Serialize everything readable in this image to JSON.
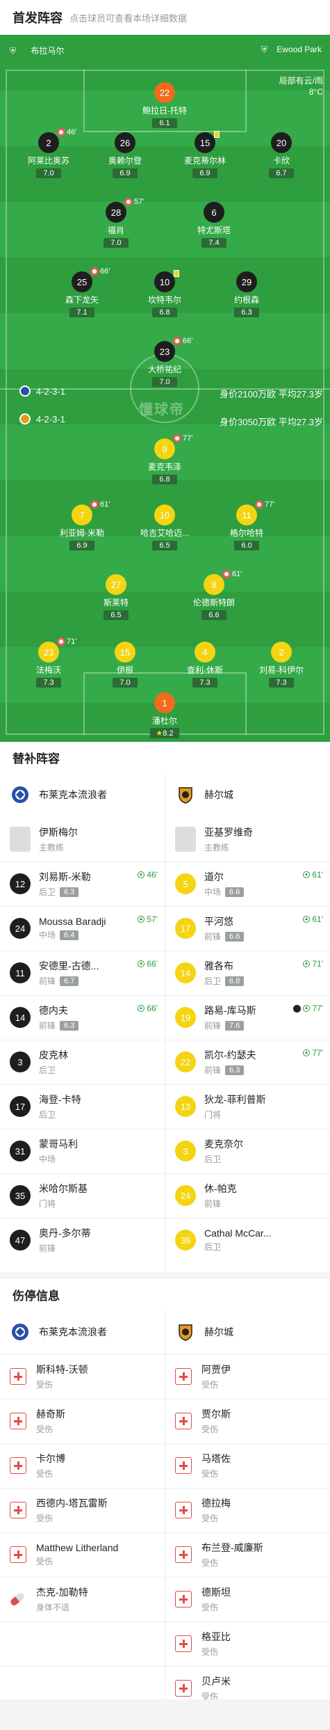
{
  "header": {
    "title": "首发阵容",
    "subtitle": "点击球员可查看本场详细数据"
  },
  "pitch": {
    "home_team": "布拉马尔",
    "away_team": "Ewood Park",
    "weather": [
      "局部有云/雨",
      "8°C"
    ],
    "watermark": "懂球帝",
    "home_formation": "4-2-3-1",
    "home_value": "身价2100万欧 平均27.3岁",
    "away_formation": "4-2-3-1",
    "away_value": "身价3050万欧 平均27.3岁"
  },
  "home_players": [
    {
      "num": "22",
      "name": "鲍拉日-托特",
      "rating": "6.1",
      "type": "gk"
    },
    {
      "num": "2",
      "name": "阿莱比奥苏",
      "rating": "7.0",
      "sub": "46'"
    },
    {
      "num": "26",
      "name": "奥赖尔登",
      "rating": "6.9"
    },
    {
      "num": "15",
      "name": "麦克蒂尔林",
      "rating": "6.9",
      "yc": true
    },
    {
      "num": "20",
      "name": "卡欣",
      "rating": "6.7"
    },
    {
      "num": "28",
      "name": "福肖",
      "rating": "7.0",
      "sub": "57'"
    },
    {
      "num": "6",
      "name": "特尤斯塔",
      "rating": "7.4"
    },
    {
      "num": "25",
      "name": "森下龙矢",
      "rating": "7.1",
      "sub": "66'"
    },
    {
      "num": "10",
      "name": "坎特韦尔",
      "rating": "6.8",
      "yc": true,
      "cap": true
    },
    {
      "num": "29",
      "name": "约根森",
      "rating": "6.3"
    },
    {
      "num": "23",
      "name": "大桥祐纪",
      "rating": "7.0",
      "sub": "66'"
    }
  ],
  "away_players": [
    {
      "num": "9",
      "name": "麦克韦泽",
      "rating": "6.8",
      "sub": "77'"
    },
    {
      "num": "7",
      "name": "利亚姆-米勒",
      "rating": "6.9",
      "sub": "61'"
    },
    {
      "num": "10",
      "name": "哈吉艾哈迈...",
      "rating": "6.5"
    },
    {
      "num": "11",
      "name": "格尔哈特",
      "rating": "6.0",
      "sub": "77'"
    },
    {
      "num": "27",
      "name": "斯莱特",
      "rating": "6.5"
    },
    {
      "num": "8",
      "name": "伦德斯特朗",
      "rating": "6.6",
      "sub": "61'"
    },
    {
      "num": "23",
      "name": "法梅沃",
      "rating": "7.3",
      "sub": "71'"
    },
    {
      "num": "15",
      "name": "伊根",
      "rating": "7.0"
    },
    {
      "num": "4",
      "name": "查利-休斯",
      "rating": "7.3"
    },
    {
      "num": "2",
      "name": "刘易-科伊尔",
      "rating": "7.3",
      "cap": true
    },
    {
      "num": "1",
      "name": "潘杜尔",
      "rating": "8.2",
      "type": "gk",
      "star": true
    }
  ],
  "subs": {
    "title": "替补阵容",
    "home_team": "布莱克本流浪者",
    "away_team": "赫尔城",
    "home_coach": {
      "name": "伊斯梅尔",
      "role": "主教练"
    },
    "away_coach": {
      "name": "亚基罗维奇",
      "role": "主教练"
    },
    "home": [
      {
        "num": "12",
        "name": "刘易斯-米勒",
        "pos": "后卫",
        "rating": "6.3",
        "in": "46'"
      },
      {
        "num": "24",
        "name": "Moussa Baradji",
        "pos": "中场",
        "rating": "6.4",
        "in": "57'"
      },
      {
        "num": "11",
        "name": "安德里-古德...",
        "pos": "前锋",
        "rating": "6.7",
        "in": "66'"
      },
      {
        "num": "14",
        "name": "德内夫",
        "pos": "前锋",
        "rating": "6.3",
        "in": "66'"
      },
      {
        "num": "3",
        "name": "皮克林",
        "pos": "后卫"
      },
      {
        "num": "17",
        "name": "海登-卡特",
        "pos": "后卫"
      },
      {
        "num": "31",
        "name": "蒙哥马利",
        "pos": "中场"
      },
      {
        "num": "35",
        "name": "米哈尔斯基",
        "pos": "门将"
      },
      {
        "num": "47",
        "name": "奥丹-多尔蒂",
        "pos": "前锋"
      }
    ],
    "away": [
      {
        "num": "5",
        "name": "道尔",
        "pos": "中场",
        "rating": "6.6",
        "in": "61'"
      },
      {
        "num": "17",
        "name": "平河悠",
        "pos": "前锋",
        "rating": "6.6",
        "in": "61'"
      },
      {
        "num": "14",
        "name": "雅各布",
        "pos": "后卫",
        "rating": "6.8",
        "in": "71'"
      },
      {
        "num": "19",
        "name": "路易-库马斯",
        "pos": "前锋",
        "rating": "7.6",
        "in": "77'",
        "goal": true
      },
      {
        "num": "22",
        "name": "凯尔-约瑟夫",
        "pos": "前锋",
        "rating": "6.3",
        "in": "77'"
      },
      {
        "num": "13",
        "name": "狄龙-菲利普斯",
        "pos": "门将"
      },
      {
        "num": "3",
        "name": "麦克奈尔",
        "pos": "后卫"
      },
      {
        "num": "24",
        "name": "休-帕克",
        "pos": "前锋"
      },
      {
        "num": "36",
        "name": "Cathal McCar...",
        "pos": "后卫"
      }
    ]
  },
  "injury": {
    "title": "伤停信息",
    "home_team": "布莱克本流浪者",
    "away_team": "赫尔城",
    "home": [
      {
        "name": "斯科特-沃顿",
        "status": "受伤"
      },
      {
        "name": "赫奇斯",
        "status": "受伤"
      },
      {
        "name": "卡尔博",
        "status": "受伤"
      },
      {
        "name": "西德内-塔瓦雷斯",
        "status": "受伤"
      },
      {
        "name": "Matthew Litherland",
        "status": "受伤"
      },
      {
        "name": "杰克-加勒特",
        "status": "身体不适",
        "ill": true
      }
    ],
    "away": [
      {
        "name": "阿贾伊",
        "status": "受伤"
      },
      {
        "name": "贾尔斯",
        "status": "受伤"
      },
      {
        "name": "马塔佐",
        "status": "受伤"
      },
      {
        "name": "德拉梅",
        "status": "受伤"
      },
      {
        "name": "布兰登-威廉斯",
        "status": "受伤"
      },
      {
        "name": "德斯坦",
        "status": "受伤"
      },
      {
        "name": "格亚比",
        "status": "受伤"
      },
      {
        "name": "贝卢米",
        "status": "受伤"
      }
    ]
  },
  "colors": {
    "pitch": "#2e9e3f",
    "home_num": "#1e1e1e",
    "away_num": "#f5d412",
    "gk": "#f26a1b",
    "sub_in": "#2a9a3b",
    "injury": "#e24a4a"
  }
}
